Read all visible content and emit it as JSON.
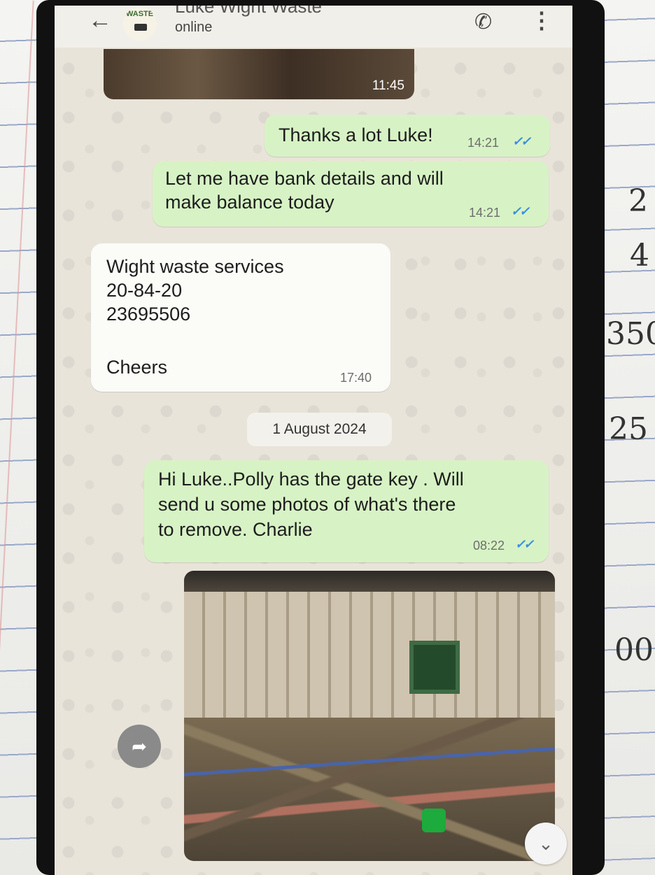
{
  "header": {
    "contact_name": "Luke Wight Waste",
    "status": "online",
    "avatar_text": "WASTE"
  },
  "messages": [
    {
      "type": "image",
      "direction": "incoming",
      "time": "11:45"
    },
    {
      "type": "text",
      "direction": "outgoing",
      "text": "Thanks a lot Luke!",
      "time": "14:21",
      "read": true
    },
    {
      "type": "text",
      "direction": "outgoing",
      "lines": [
        "Let me have bank details and will",
        "make balance today"
      ],
      "time": "14:21",
      "read": true
    },
    {
      "type": "text",
      "direction": "incoming",
      "lines": [
        "Wight waste services",
        "20-84-20",
        "23695506",
        "",
        "Cheers"
      ],
      "time": "17:40"
    },
    {
      "type": "text",
      "direction": "outgoing",
      "lines": [
        "Hi Luke..Polly has the gate key . Will",
        "send u some photos of what's there",
        "to remove. Charlie"
      ],
      "time": "08:22",
      "read": true
    },
    {
      "type": "image",
      "direction": "outgoing"
    }
  ],
  "date_separator": "1 August 2024",
  "icons": {
    "back": "arrow-left",
    "call": "phone-add",
    "menu": "kebab-menu",
    "forward": "forward-arrow",
    "scroll_down": "double-chevron-down"
  },
  "colors": {
    "outgoing_bubble": "#d7f3c5",
    "incoming_bubble": "#fbfbf8",
    "read_tick": "#3b8fe0",
    "chat_background": "#e9e4da"
  }
}
